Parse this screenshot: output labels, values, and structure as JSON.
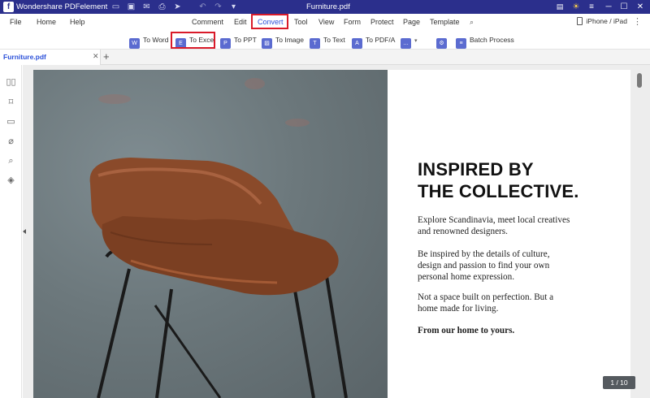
{
  "titlebar": {
    "app_name": "Wondershare PDFelement",
    "doc_title": "Furniture.pdf"
  },
  "menubar": {
    "file": "File",
    "home": "Home",
    "help": "Help",
    "items": [
      "Comment",
      "Edit",
      "Convert",
      "Tool",
      "View",
      "Form",
      "Protect",
      "Page",
      "Template"
    ],
    "active_item": "Convert",
    "device": "iPhone / iPad"
  },
  "ribbon": {
    "to_word": "To Word",
    "to_excel": "To Excel",
    "to_ppt": "To PPT",
    "to_image": "To Image",
    "to_text": "To Text",
    "to_pdfa": "To PDF/A",
    "batch_process": "Batch Process"
  },
  "tabs": {
    "active_tab": "Furniture.pdf"
  },
  "document": {
    "headline_line1": "INSPIRED BY",
    "headline_line2": "THE COLLECTIVE.",
    "para1_line1": "Explore Scandinavia, meet local creatives",
    "para1_line2": "and renowned designers.",
    "para2_line1": "Be inspired by the details of culture,",
    "para2_line2": "design and passion to find your own",
    "para2_line3": "personal home expression.",
    "para3_line1": "Not a space built on perfection. But a",
    "para3_line2": "home made for living.",
    "para4": "From our home to yours."
  },
  "page_indicator": "1 / 10",
  "colors": {
    "titlebar": "#2b2f8c",
    "accent": "#2b50d9",
    "highlight": "#d91b2a",
    "chair": "#8a4a2a"
  }
}
